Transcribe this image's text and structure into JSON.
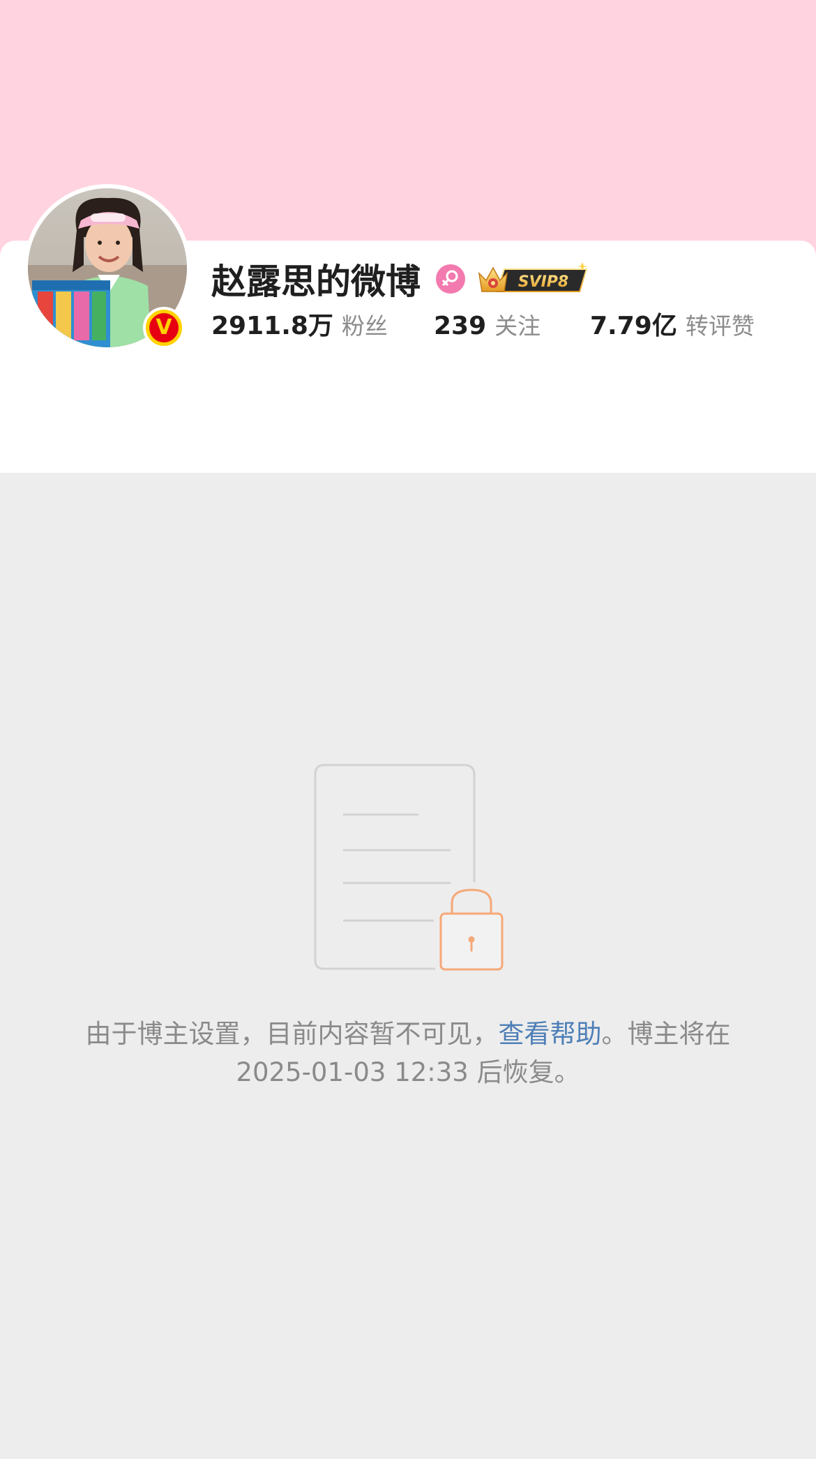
{
  "profile": {
    "name": "赵露思的微博",
    "gender_icon": "female-icon",
    "membership_badge": "SVIP8",
    "verified_badge": "V",
    "stats": [
      {
        "value": "2911.8万",
        "label": "粉丝"
      },
      {
        "value": "239",
        "label": "关注"
      },
      {
        "value": "7.79亿",
        "label": "转评赞"
      }
    ]
  },
  "notice": {
    "text_before_link": "由于博主设置，目前内容暂不可见，",
    "link_text": "查看帮助",
    "text_after_link": "。博主将在 2025-01-03 12:33 后恢复。"
  },
  "colors": {
    "cover": "#ffd3e0",
    "card": "#ffffff",
    "background": "#ededed",
    "link": "#4e7fb7",
    "lock": "#f6a878",
    "gender": "#f37aae",
    "verified": "#e60012"
  }
}
